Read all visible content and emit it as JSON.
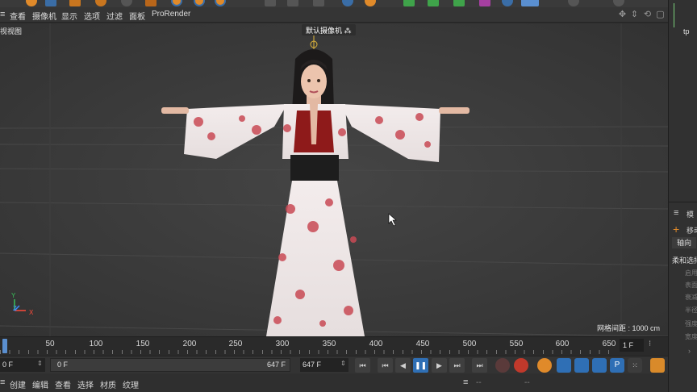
{
  "menubar": {
    "items": [
      "查看",
      "摄像机",
      "显示",
      "选项",
      "过滤",
      "面板",
      "ProRender"
    ]
  },
  "viewport": {
    "label": "视视图",
    "camera_label": "默认摄像机",
    "grid_spacing": "网格间距 : 1000 cm",
    "axes": {
      "y": "Y",
      "z": "Z",
      "x": "X"
    }
  },
  "timeline": {
    "ticks": [
      "50",
      "100",
      "150",
      "200",
      "250",
      "300",
      "350",
      "400",
      "450",
      "500",
      "550",
      "600",
      "650"
    ],
    "current_frame": "1 F"
  },
  "playback": {
    "start_field": "0 F",
    "range_start": "0 F",
    "range_end": "647 F",
    "end_field": "647 F"
  },
  "bottom_menu": {
    "items": [
      "创建",
      "编辑",
      "查看",
      "选择",
      "材质",
      "纹理"
    ],
    "right_items": [
      "--",
      "--"
    ]
  },
  "right_panel": {
    "mode_label": "模",
    "move_label": "移动",
    "axis_tab": "轴向",
    "soft_select": "柔和选择",
    "sub_items": [
      "启用",
      "表面",
      "衰减",
      "半径",
      "强度",
      "宽度"
    ]
  },
  "colors": {
    "accent_blue": "#2f6fb5",
    "toolbar_orange": "#e08a2a",
    "axis_x": "#ff4a3a",
    "axis_y": "#38c05a",
    "axis_z": "#3d8cff"
  }
}
